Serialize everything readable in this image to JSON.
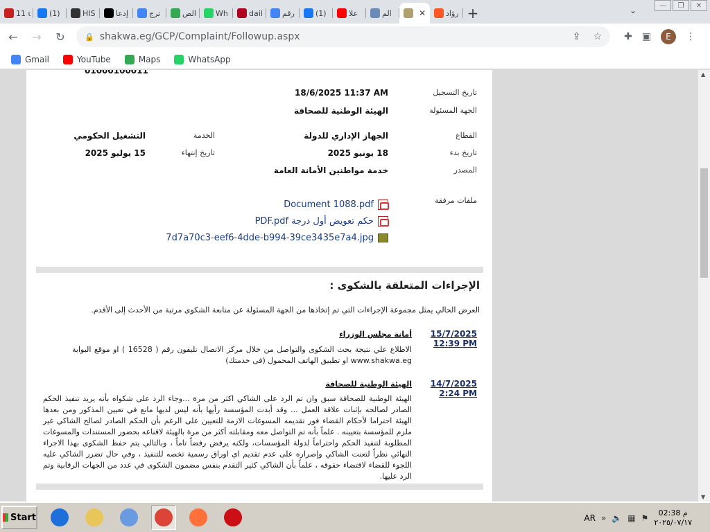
{
  "tabs": [
    {
      "title": "11 ι",
      "icon": "gmail-icon",
      "color": "#c5221f"
    },
    {
      "title": "(1)",
      "icon": "facebook-icon",
      "color": "#1877f2"
    },
    {
      "title": "HIS",
      "icon": "his-icon",
      "color": "#333333"
    },
    {
      "title": "إدعا",
      "icon": "threads-icon",
      "color": "#000000"
    },
    {
      "title": "ترج",
      "icon": "translate-icon",
      "color": "#4285f4"
    },
    {
      "title": "الص",
      "icon": "drive-icon",
      "color": "#34a853"
    },
    {
      "title": "Wh",
      "icon": "whatsapp-icon",
      "color": "#25d366"
    },
    {
      "title": "dail",
      "icon": "news-icon",
      "color": "#b00020"
    },
    {
      "title": "رقم",
      "icon": "google-icon",
      "color": "#4285f4"
    },
    {
      "title": "(1)",
      "icon": "facebook-icon",
      "color": "#1877f2"
    },
    {
      "title": "علا",
      "icon": "youtube-icon",
      "color": "#ff0000"
    },
    {
      "title": "الم",
      "icon": "site-icon",
      "color": "#6a8bb8"
    },
    {
      "title": "",
      "icon": "shakwa-icon",
      "color": "#b0a070",
      "active": true
    },
    {
      "title": "رؤاد",
      "icon": "blogger-icon",
      "color": "#ff5722"
    }
  ],
  "new_tab_label": "+",
  "tab_search_label": "⌄",
  "window_controls": {
    "minimize": "—",
    "restore": "❐",
    "close": "✕"
  },
  "toolbar": {
    "back": "←",
    "forward": "→",
    "reload": "↻",
    "url": "shakwa.eg/GCP/Complaint/Followup.aspx",
    "profile_initial": "E"
  },
  "bookmarks": [
    {
      "label": "Gmail",
      "icon": "google-icon",
      "color": "#4285f4"
    },
    {
      "label": "YouTube",
      "icon": "youtube-icon",
      "color": "#ff0000"
    },
    {
      "label": "Maps",
      "icon": "maps-icon",
      "color": "#34a853"
    },
    {
      "label": "WhatsApp",
      "icon": "whatsapp-icon",
      "color": "#25d366"
    }
  ],
  "complaint": {
    "top_cut_value": "01000100011",
    "registration_date_label": "تاريخ التسجيل",
    "registration_date": "18/6/2025 11:37 AM",
    "responsible_label": "الجهة المسئولة",
    "responsible": "الهيئة الوطنية للصحافة",
    "sector_label": "القطاع",
    "sector": "الجهاز الإداري للدولة",
    "service_label": "الخدمة",
    "service": "التشغيل الحكومي",
    "start_date_label": "تاريخ بدء",
    "start_date": "18 يونيو 2025",
    "end_date_label": "تاريخ إنتهاء",
    "end_date": "15 يوليو 2025",
    "source_label": "المصدر",
    "source": "خدمة مواطنين الأمانة العامة",
    "attachments_label": "ملفات مرفقة",
    "attachments": [
      {
        "name": "Document 1088.pdf",
        "type": "pdf"
      },
      {
        "name": "حكم تعويض أول درجة PDF.pdf",
        "type": "pdf"
      },
      {
        "name": "7d7a70c3-eef6-4dde-b994-39ce3435e7a4.jpg",
        "type": "jpg"
      }
    ]
  },
  "actions": {
    "title": "الإجراءات المتعلقة بالشكوى :",
    "intro": "العرض الحالي يمثل مجموعة الإجراءات التي تم إتخاذها من الجهة المسئولة عن متابعة الشكوى مرتبة من الأحدث إلى الأقدم.",
    "items": [
      {
        "date": "15/7/2025",
        "time": "12:39 PM",
        "org": "أمانة مجلس الوزراء",
        "text": "الاطلاع علي نتيجة بحث الشكوى والتواصل من خلال مركز الاتصال تليفون رقم ( 16528 ) او موقع البوابة www.shakwa.eg او تطبيق الهاتف المحمول (فى خدمتك)"
      },
      {
        "date": "14/7/2025",
        "time": "2:24 PM",
        "org": "الهيئة الوطنية للصحافة",
        "text": "الهيئة الوطنية للصحافة سبق وان تم الرد على الشاكي اكثر من مرة ...وجاء الرد على شكواه بأنه يريد تنفيذ الحكم الصادر لصالحه بإثبات علاقة العمل ... وقد أبدت المؤسسة رأيها بأنه ليس لديها مانع في تعيين المذكور ومن بعدها الهيئة احتراما لأحكام القضاء فور تقديمه المسوغات الازمة للتعيين على الرغم بأن الحكم الصادر لصالح الشاكي غير ملزم للمؤسسة بتعيينه . علماً بأنه تم التواصل معه ومقابلته أكثر من مرة بالهيئة لاقناعه بحضور المستندات والمسوغات المطلوبة لتنفيذ الحكم واحتراماً لدولة المؤسسات، ولكنه يرفض رفضاً تاماً ، وبالتالي يتم حفظ الشكوى بهذا الاجراء النهائي نظراً لتعنت الشاكي وإصراره على عدم تقديم اي اوراق رسمية تخصه للتنفيذ ، وفي حال تضرر الشاكي عليه اللجوء للقضاء لاقتضاء حقوقه ، علماً بأن الشاكي كثير التقدم بنفس مضمون الشكوى في عدد من الجهات الرقابية وتم الرد عليها."
      }
    ]
  },
  "taskbar": {
    "start_label": "Start",
    "apps": [
      {
        "icon": "internet-explorer-icon",
        "color": "#1e6fd9"
      },
      {
        "icon": "folder-icon",
        "color": "#e8c65a"
      },
      {
        "icon": "media-player-icon",
        "color": "#6a9be0"
      },
      {
        "icon": "chrome-icon",
        "color": "#db4437",
        "active": true
      },
      {
        "icon": "firefox-icon",
        "color": "#ff7139"
      },
      {
        "icon": "opera-icon",
        "color": "#cc0f16"
      }
    ],
    "language": "AR",
    "time": "02:38 م",
    "date": "٢٠٢٥/٠٧/١٧"
  }
}
